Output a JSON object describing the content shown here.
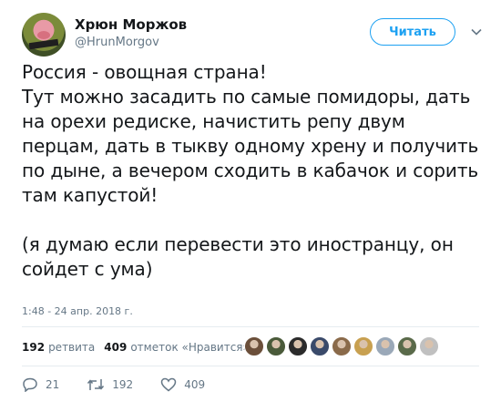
{
  "user": {
    "name": "Хрюн Моржов",
    "handle": "@HrunMorgov"
  },
  "follow_label": "Читать",
  "tweet": {
    "text": "Россия - овощная страна!\nТут можно засадить по самые помидоры, дать на орехи редиске, начистить репу двум перцам, дать в тыкву одному хрену и получить по дыне, а вечером сходить в кабачок и сорить там капустой!\n\n(я думаю если перевести это иностранцу, он сойдет с ума)",
    "time": "1:48 - 24 апр. 2018 г."
  },
  "stats": {
    "retweets_count": "192",
    "retweets_label": "ретвита",
    "likes_count": "409",
    "likes_label": "отметок «Нравится»"
  },
  "likers_colors": [
    "#6b4f3a",
    "#4a5a3a",
    "#2b2b2b",
    "#3a4a6a",
    "#8a6a4a",
    "#c8a050",
    "#9aa8b8",
    "#5a6a4a",
    "#c0c0c0"
  ],
  "actions": {
    "replies": "21",
    "retweets": "192",
    "likes": "409"
  },
  "colors": {
    "accent": "#1da1f2",
    "muted": "#657786",
    "text": "#14171a"
  }
}
